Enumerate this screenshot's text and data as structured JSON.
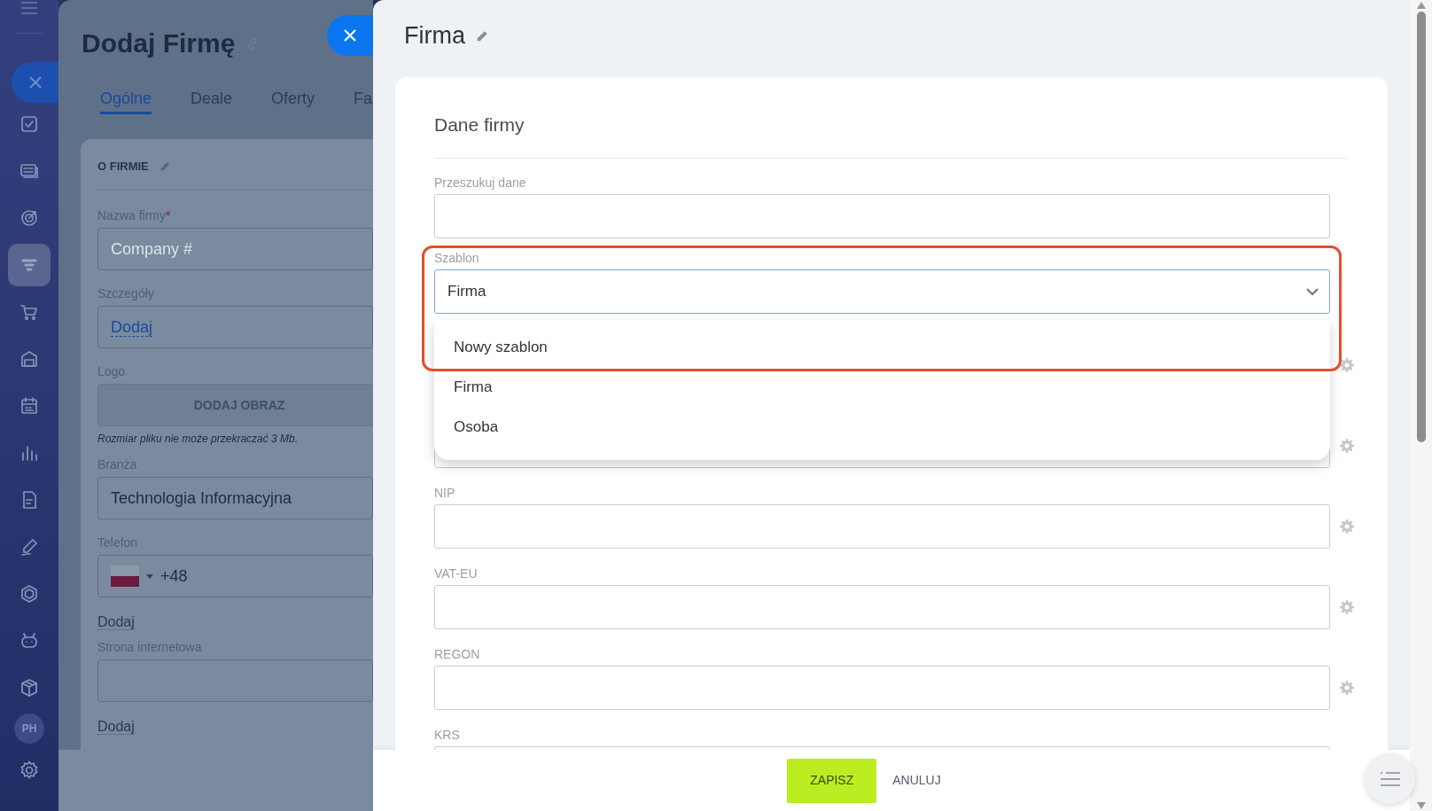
{
  "sidebar": {
    "items": [
      {
        "selected": false
      },
      {
        "selected": false
      },
      {
        "selected": false
      },
      {
        "selected": true
      },
      {
        "selected": false
      },
      {
        "selected": false
      },
      {
        "selected": false
      },
      {
        "selected": false
      },
      {
        "selected": false
      },
      {
        "selected": false
      },
      {
        "selected": false
      },
      {
        "selected": false
      },
      {
        "selected": false
      }
    ],
    "avatar": "PH"
  },
  "background_panel": {
    "title": "Dodaj Firmę",
    "tabs": [
      {
        "label": "Ogólne",
        "selected": true
      },
      {
        "label": "Deale",
        "selected": false
      },
      {
        "label": "Oferty",
        "selected": false
      },
      {
        "label": "Fa",
        "selected": false
      }
    ],
    "section": "O FIRMIE",
    "fields": [
      {
        "kind": "input",
        "label": "Nazwa firmy",
        "required_mark": "*",
        "placeholder": "Company #"
      },
      {
        "kind": "link",
        "label": "Szczegóły",
        "value": "Dodaj"
      },
      {
        "kind": "upload",
        "label": "Logo",
        "button": "DODAJ OBRAZ",
        "note": "Rozmiar pliku nie może przekraczać 3 Mb."
      },
      {
        "kind": "input",
        "label": "Branża",
        "value": "Technologia Informacyjna"
      },
      {
        "kind": "phone",
        "label": "Telefon",
        "value": "+48"
      },
      {
        "kind": "add",
        "value": "Dodaj"
      },
      {
        "kind": "input",
        "label": "Strona internetowa"
      },
      {
        "kind": "add",
        "value": "Dodaj"
      }
    ]
  },
  "slider": {
    "title": "Firma",
    "section_title": "Dane firmy",
    "search": {
      "label": "Przeszukuj dane"
    },
    "template": {
      "label": "Szablon",
      "value": "Firma",
      "open": true,
      "options": [
        "Nowy szablon",
        "Firma",
        "Osoba"
      ]
    },
    "fields": [
      {
        "settings_icon": true
      },
      {
        "settings_icon": true
      },
      {
        "label": "NIP",
        "settings_icon": true
      },
      {
        "label": "VAT-EU",
        "settings_icon": true
      },
      {
        "label": "REGON",
        "settings_icon": true
      },
      {
        "label": "KRS"
      }
    ],
    "buttons": {
      "save": "ZAPISZ",
      "cancel": "ANULUJ"
    }
  }
}
